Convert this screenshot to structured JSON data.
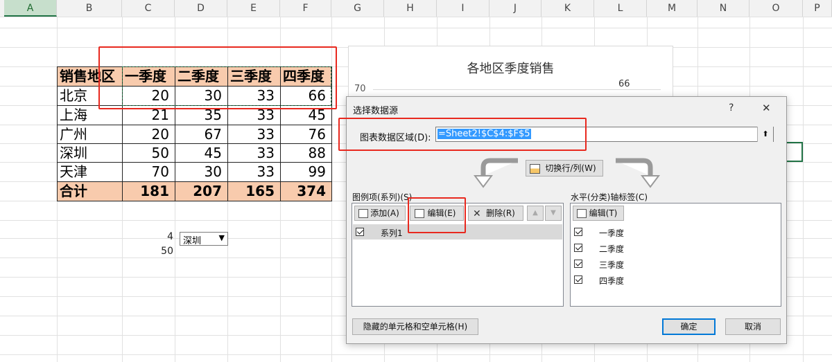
{
  "columns": [
    "A",
    "B",
    "C",
    "D",
    "E",
    "F",
    "G",
    "H",
    "I",
    "J",
    "K",
    "L",
    "M",
    "N",
    "O",
    "P"
  ],
  "table": {
    "header": [
      "销售地区",
      "一季度",
      "二季度",
      "三季度",
      "四季度"
    ],
    "rows": [
      [
        "北京",
        "20",
        "30",
        "33",
        "66"
      ],
      [
        "上海",
        "21",
        "35",
        "33",
        "45"
      ],
      [
        "广州",
        "20",
        "67",
        "33",
        "76"
      ],
      [
        "深圳",
        "50",
        "45",
        "33",
        "88"
      ],
      [
        "天津",
        "70",
        "30",
        "33",
        "99"
      ]
    ],
    "total": [
      "合计",
      "181",
      "207",
      "165",
      "374"
    ]
  },
  "side_values": {
    "index": "4",
    "value": "50"
  },
  "dropdown": {
    "selected": "深圳"
  },
  "chart": {
    "title": "各地区季度销售",
    "y_tick": "70",
    "data_label": "66"
  },
  "dialog": {
    "title": "选择数据源",
    "help": "?",
    "close": "✕",
    "range_label": "图表数据区域(D):",
    "range_value": "=Sheet2!$C$4:$F$5",
    "switch_label": "切换行/列(W)",
    "legend_title": "图例项(系列)(S)",
    "add_label": "添加(A)",
    "edit_label": "编辑(E)",
    "delete_label": "删除(R)",
    "series": [
      "系列1"
    ],
    "axis_title": "水平(分类)轴标签(C)",
    "axis_edit_label": "编辑(T)",
    "axis_items": [
      "一季度",
      "二季度",
      "三季度",
      "四季度"
    ],
    "hidden_cells_label": "隐藏的单元格和空单元格(H)",
    "ok_label": "确定",
    "cancel_label": "取消"
  },
  "colors": {
    "header_fill": "#f8cbad",
    "highlight_red": "#e8281e",
    "excel_green": "#217346"
  }
}
